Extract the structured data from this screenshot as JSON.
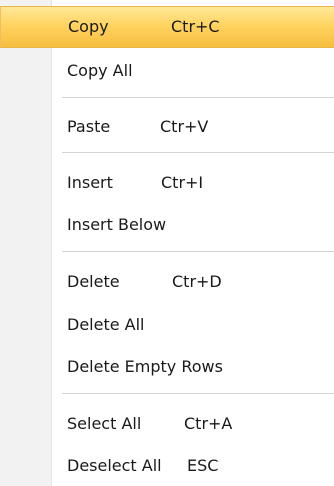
{
  "menu": {
    "items": [
      {
        "label": "Copy",
        "shortcut": "Ctr+C"
      },
      {
        "label": "Copy All",
        "shortcut": ""
      },
      {
        "label": "Paste",
        "shortcut": "Ctr+V"
      },
      {
        "label": "Insert",
        "shortcut": "Ctr+I"
      },
      {
        "label": "Insert Below",
        "shortcut": ""
      },
      {
        "label": "Delete",
        "shortcut": "Ctr+D"
      },
      {
        "label": "Delete All",
        "shortcut": ""
      },
      {
        "label": "Delete Empty Rows",
        "shortcut": ""
      },
      {
        "label": "Select All",
        "shortcut": "Ctr+A"
      },
      {
        "label": "Deselect All",
        "shortcut": "ESC"
      }
    ],
    "highlighted_item": "Copy"
  },
  "colors": {
    "highlight_top": "#ffe89a",
    "highlight_bottom": "#f7be3f",
    "gutter": "#f2f2f2",
    "separator": "#d4d4d4"
  }
}
